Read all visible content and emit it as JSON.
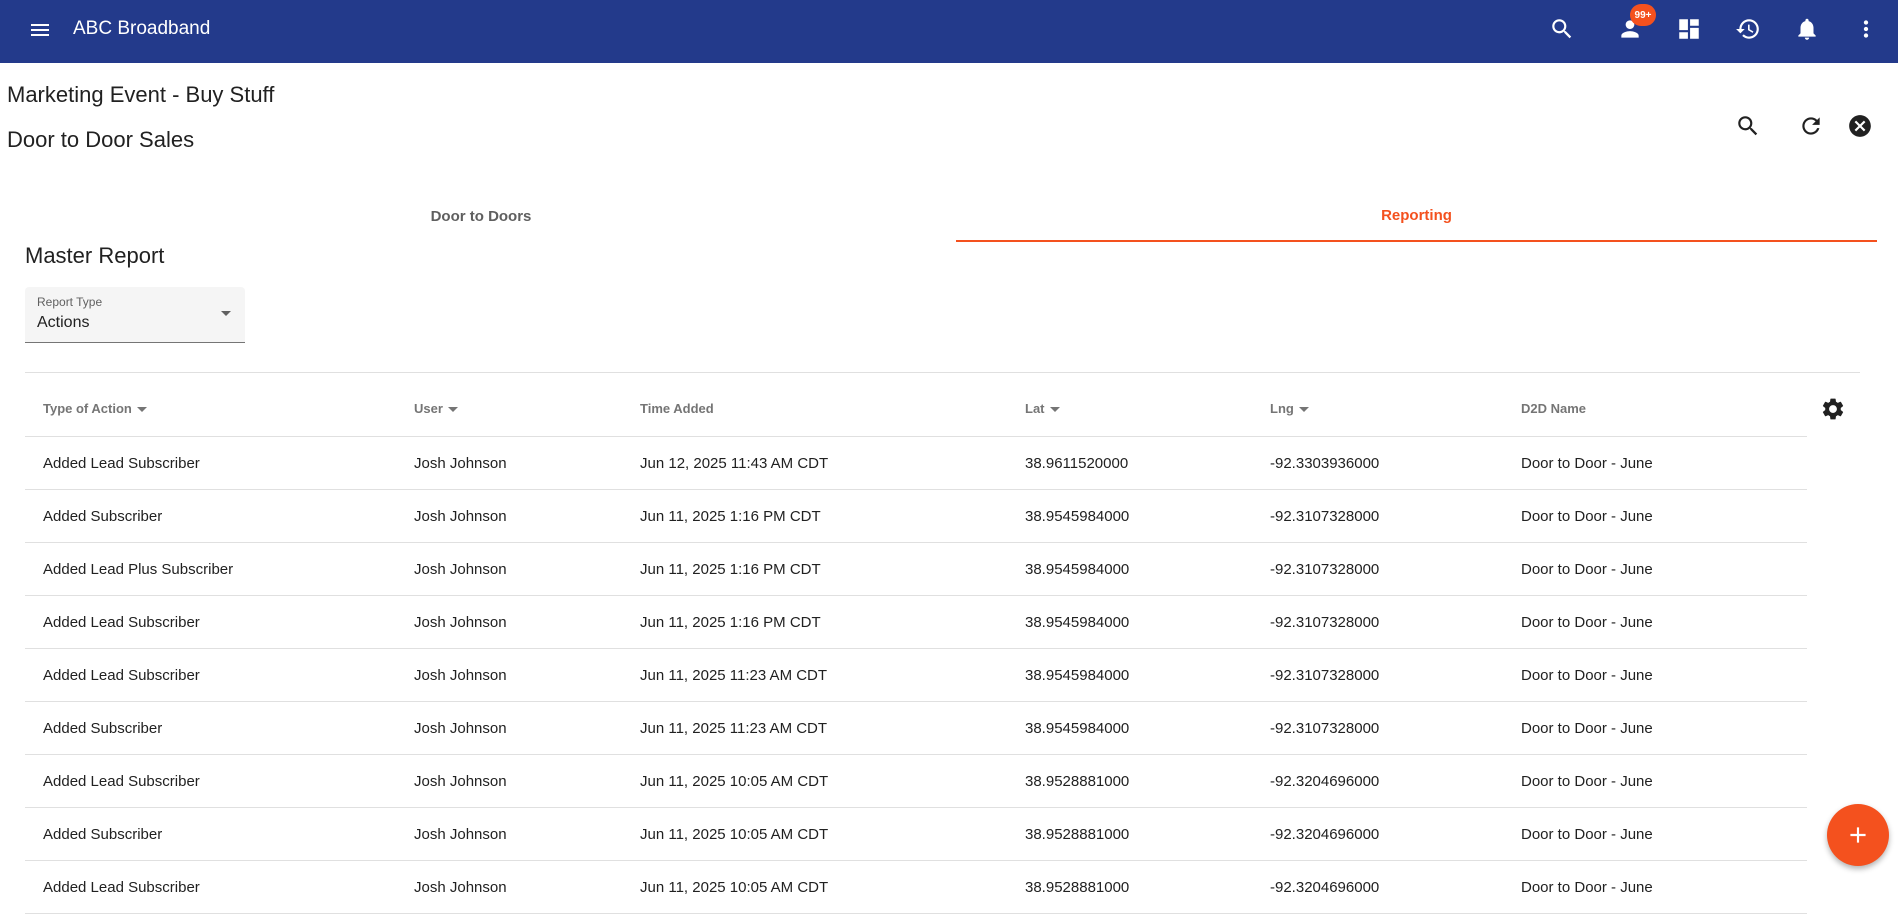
{
  "app": {
    "title": "ABC Broadband",
    "badge_count": "99+"
  },
  "icons": {
    "menu": "menu-icon",
    "search": "search-icon",
    "account": "account-icon",
    "dashboard": "dashboard-icon",
    "history": "history-icon",
    "notifications": "bell-icon",
    "more": "more-vert-icon",
    "refresh": "refresh-icon",
    "close": "close-circle-icon",
    "settings": "gear-icon",
    "add": "plus-icon"
  },
  "colors": {
    "appbar": "#233a8b",
    "accent": "#f4511e"
  },
  "page": {
    "title": "Marketing Event - Buy Stuff",
    "subtitle": "Door to Door Sales"
  },
  "tabs": [
    {
      "label": "Door to Doors",
      "active": false
    },
    {
      "label": "Reporting",
      "active": true
    }
  ],
  "report": {
    "title": "Master Report",
    "report_type": {
      "label": "Report Type",
      "value": "Actions"
    },
    "columns": [
      "Type of Action",
      "User",
      "Time Added",
      "Lat",
      "Lng",
      "D2D Name"
    ],
    "rows": [
      [
        "Added Lead Subscriber",
        "Josh Johnson",
        "Jun 12, 2025 11:43 AM CDT",
        "38.9611520000",
        "-92.3303936000",
        "Door to Door - June"
      ],
      [
        "Added Subscriber",
        "Josh Johnson",
        "Jun 11, 2025 1:16 PM CDT",
        "38.9545984000",
        "-92.3107328000",
        "Door to Door - June"
      ],
      [
        "Added Lead Plus Subscriber",
        "Josh Johnson",
        "Jun 11, 2025 1:16 PM CDT",
        "38.9545984000",
        "-92.3107328000",
        "Door to Door - June"
      ],
      [
        "Added Lead Subscriber",
        "Josh Johnson",
        "Jun 11, 2025 1:16 PM CDT",
        "38.9545984000",
        "-92.3107328000",
        "Door to Door - June"
      ],
      [
        "Added Lead Subscriber",
        "Josh Johnson",
        "Jun 11, 2025 11:23 AM CDT",
        "38.9545984000",
        "-92.3107328000",
        "Door to Door - June"
      ],
      [
        "Added Subscriber",
        "Josh Johnson",
        "Jun 11, 2025 11:23 AM CDT",
        "38.9545984000",
        "-92.3107328000",
        "Door to Door - June"
      ],
      [
        "Added Lead Subscriber",
        "Josh Johnson",
        "Jun 11, 2025 10:05 AM CDT",
        "38.9528881000",
        "-92.3204696000",
        "Door to Door - June"
      ],
      [
        "Added Subscriber",
        "Josh Johnson",
        "Jun 11, 2025 10:05 AM CDT",
        "38.9528881000",
        "-92.3204696000",
        "Door to Door - June"
      ],
      [
        "Added Lead Subscriber",
        "Josh Johnson",
        "Jun 11, 2025 10:05 AM CDT",
        "38.9528881000",
        "-92.3204696000",
        "Door to Door - June"
      ]
    ]
  }
}
